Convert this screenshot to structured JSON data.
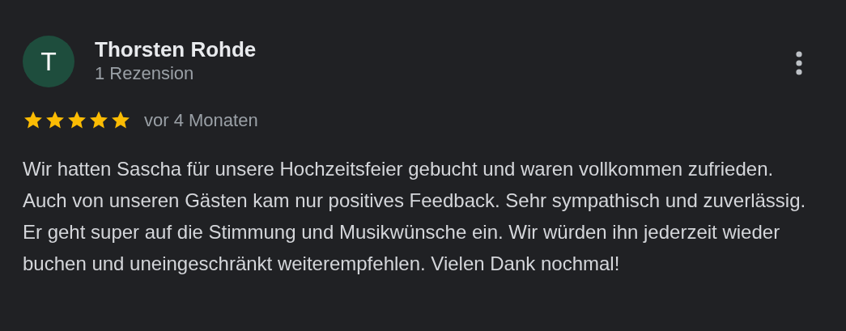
{
  "review": {
    "avatar_letter": "T",
    "author": "Thorsten Rohde",
    "author_meta": "1 Rezension",
    "stars": 5,
    "time": "vor 4 Monaten",
    "text": "Wir hatten Sascha für unsere Hochzeitsfeier gebucht und waren vollkommen zufrieden. Auch von unseren Gästen kam nur positives Feedback. Sehr sympathisch und zuverlässig. Er geht super auf die Stimmung und Musikwünsche ein. Wir würden ihn jederzeit wieder buchen und uneingeschränkt weiterempfehlen. Vielen Dank nochmal!"
  }
}
